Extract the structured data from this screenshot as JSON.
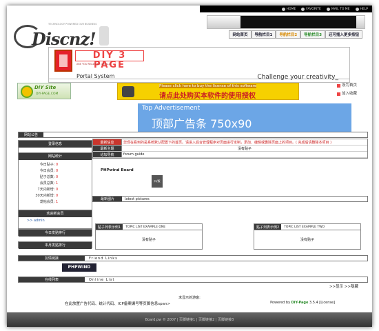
{
  "topbar": {
    "items": [
      "HOME",
      "FAVORITE",
      "MAIL TO ME",
      "HELP"
    ]
  },
  "logo": {
    "tagline": "TECHNOLOGY POWERED OUR BUSINESS",
    "text": "Discnz!"
  },
  "nav": [
    "网站首页",
    "导航栏目1",
    "导航栏目2",
    "导航栏目3",
    "还可插入更多按钮"
  ],
  "banner": {
    "diy": "DIY 3 PAGE",
    "sub": "ARE YOU READY TO DIY ALL?",
    "portal": "Portal System",
    "challenge": "Challenge your creativity_"
  },
  "ads": {
    "diysite": "DiY Site",
    "diysite_sub": "DIY-PAGE.COM",
    "buy_en": "Please click here to buy the license of this software",
    "buy_cn": "请点此处购买本软件的使用授权",
    "set_home": "设为首页",
    "add_fav": "加入收藏",
    "top_en": "Top Advertisement",
    "top_cn": "顶部广告条 750x90"
  },
  "notice": {
    "label": "网站公告"
  },
  "left": {
    "login": "登录信息",
    "stats_title": "网站统计",
    "stats": [
      [
        "今日贴子:",
        "0"
      ],
      [
        "今日会员:",
        "0"
      ],
      [
        "贴子总数:",
        "0"
      ],
      [
        "会员总数:",
        "1"
      ],
      [
        "7天内新增:",
        "0"
      ],
      [
        "30天内新增:",
        "0"
      ],
      [
        "发帖会员:",
        "1"
      ]
    ],
    "new_members": "欢迎新会员",
    "member": ">> admin",
    "today_rank": "今日发贴排行",
    "month_rank": "本月发贴排行"
  },
  "main": {
    "rows": [
      {
        "k": "最新信息",
        "v": "您现在看到的是系统默认配置下的首页。请进入后台管理程序对页面进行定制，添加、编辑或删除页面上的项目。( 完成后请删除本项目 )"
      },
      {
        "k": "最新主题",
        "v": "没有贴子"
      },
      {
        "k": "论坛导航",
        "v": "forum guide"
      }
    ],
    "phpwind": "PHPwind Board",
    "board_icon": "口/版",
    "latest_k": "最新图片",
    "latest_v": "latest pictures"
  },
  "lists": [
    {
      "k": "贴子列表示例1",
      "t": "TOPIC LIST EXAMPLE ONE",
      "body": "没有贴子"
    },
    {
      "k": "贴子列表示例2",
      "t": "TOPIC LIST EXAMPLE TWO",
      "body": "没有贴子"
    }
  ],
  "links": {
    "label": "友情链接",
    "title": "Friend Links",
    "phw": "PHPWIND"
  },
  "online": {
    "label": "在线列表",
    "title": "Online List",
    "show": ">>显示",
    "hide": ">>隐藏"
  },
  "footer": {
    "visitors": "未显示的游客:",
    "ads": "在此放置广告代码、统计代码、ICP备案编号等页脚信息span>",
    "powered": "Powered by ",
    "brand": "DiY-Page",
    "ver": " 3.5.4  [License]",
    "bottom": "Board.pw © 2007  |  页脚链接1  |  页脚链接2  |  页脚链接3"
  }
}
